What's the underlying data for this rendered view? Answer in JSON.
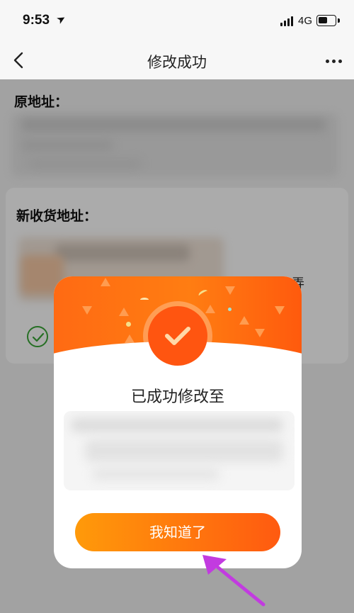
{
  "status_bar": {
    "time": "9:53",
    "network": "4G",
    "battery_level": 0.55
  },
  "nav": {
    "title": "修改成功",
    "back_icon": "chevron-left-icon",
    "more_icon": "more-dots-icon"
  },
  "original_address": {
    "label": "原地址："
  },
  "new_address": {
    "label": "新收货地址：",
    "partial_text": "弄"
  },
  "dialog": {
    "title": "已成功修改至",
    "confirm_label": "我知道了",
    "badge_icon": "check-icon"
  },
  "colors": {
    "accent_orange": "#ff6a13",
    "button_gradient_start": "#ff9a0a",
    "button_gradient_end": "#ff5a10",
    "success_green": "#3aa637",
    "annotation_arrow": "#c23be0"
  }
}
